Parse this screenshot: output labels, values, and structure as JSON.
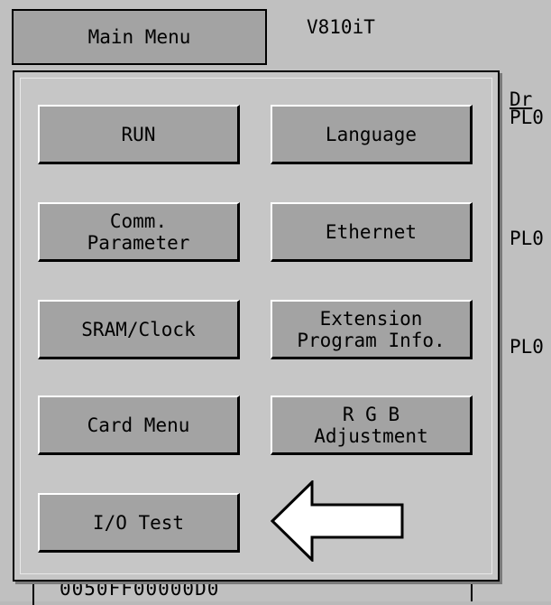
{
  "header": {
    "title": "Main Menu",
    "model": "V810iT"
  },
  "background": {
    "labels": [
      "Dr",
      "PL0",
      "PL0",
      "PL0"
    ],
    "code": "0050FF00000D0"
  },
  "menu": {
    "buttons": [
      {
        "label": "RUN"
      },
      {
        "label": "Language"
      },
      {
        "label": "Comm.\nParameter"
      },
      {
        "label": "Ethernet"
      },
      {
        "label": "SRAM/Clock"
      },
      {
        "label": "Extension\nProgram Info."
      },
      {
        "label": "Card Menu"
      },
      {
        "label": "R G B\nAdjustment"
      },
      {
        "label": "I/O Test"
      }
    ]
  },
  "annotation": {
    "arrow_target": "I/O Test",
    "arrow_icon": "left-arrow-icon"
  }
}
